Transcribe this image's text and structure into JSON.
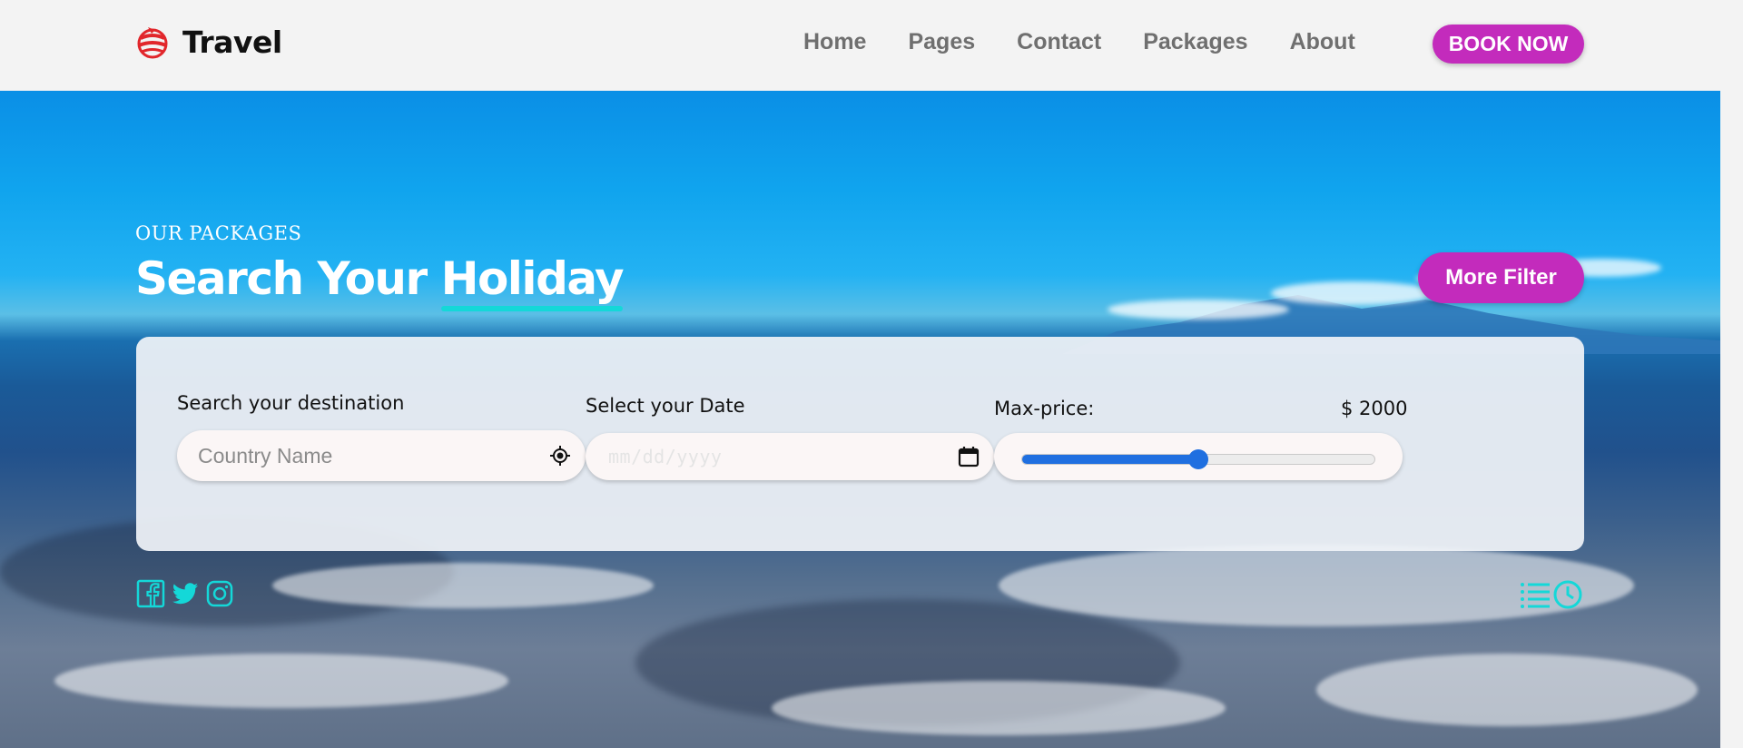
{
  "brand": {
    "name": "Travel",
    "logo_icon": "globe-logo-icon"
  },
  "nav": {
    "items": [
      {
        "label": "Home"
      },
      {
        "label": "Pages"
      },
      {
        "label": "Contact"
      },
      {
        "label": "Packages"
      },
      {
        "label": "About"
      }
    ],
    "book_label": "BOOK NOW"
  },
  "hero": {
    "eyebrow": "OUR PACKAGES",
    "title_part1": "Search Your ",
    "title_highlight": "Holiday",
    "more_filter_label": "More Filter"
  },
  "search": {
    "destination_label": "Search your destination",
    "destination_placeholder": "Country Name",
    "destination_icon": "location-target-icon",
    "date_label": "Select your Date",
    "date_placeholder": "mm/dd/yyyy",
    "date_icon": "calendar-icon",
    "price_label": "Max-price:",
    "price_value": "$ 2000",
    "price_slider_fraction": 0.5
  },
  "socials": [
    "facebook-icon",
    "twitter-icon",
    "instagram-icon"
  ],
  "right_icons": [
    "list-icon",
    "clock-icon"
  ],
  "colors": {
    "accent": "#c32bbc",
    "highlight": "#14d8d8",
    "slider": "#1f6fe0",
    "icon": "#14d8d8"
  }
}
